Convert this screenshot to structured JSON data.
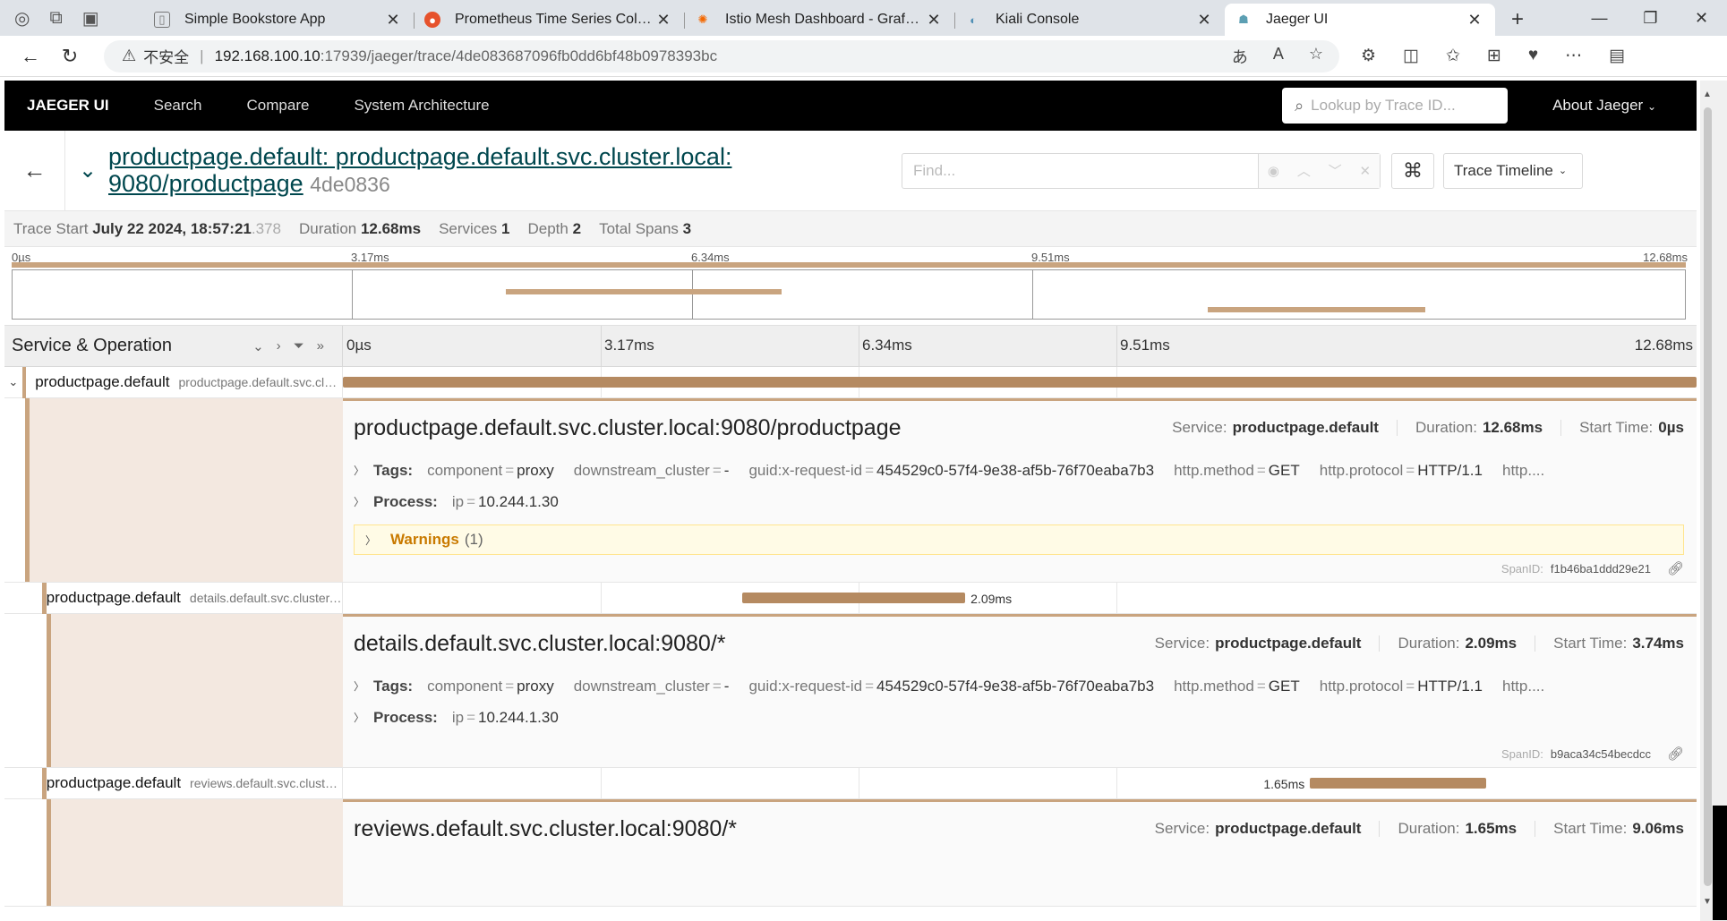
{
  "browser": {
    "tabs": [
      {
        "title": "Simple Bookstore App",
        "icon": "page-icon"
      },
      {
        "title": "Prometheus Time Series Collectio",
        "icon": "prometheus-icon"
      },
      {
        "title": "Istio Mesh Dashboard - Grafana",
        "icon": "grafana-icon"
      },
      {
        "title": "Kiali Console",
        "icon": "kiali-icon"
      },
      {
        "title": "Jaeger UI",
        "icon": "jaeger-icon"
      }
    ],
    "address": {
      "security": "不安全",
      "host": "192.168.100.10",
      "path": ":17939/jaeger/trace/4de083687096fb0dd6bf48b0978393bc"
    }
  },
  "nav": {
    "brand": "JAEGER UI",
    "links": [
      "Search",
      "Compare",
      "System Architecture"
    ],
    "lookup_placeholder": "Lookup by Trace ID...",
    "about": "About Jaeger"
  },
  "trace": {
    "title_line1": "productpage.default: productpage.default.svc.cluster.local:",
    "title_line2": "9080/productpage",
    "trace_id_short": "4de0836",
    "find_placeholder": "Find...",
    "view_mode": "Trace Timeline",
    "stats": {
      "start_label": "Trace Start",
      "start_value": "July 22 2024, 18:57:21",
      "start_ms": ".378",
      "duration_label": "Duration",
      "duration_value": "12.68ms",
      "services_label": "Services",
      "services_value": "1",
      "depth_label": "Depth",
      "depth_value": "2",
      "spans_label": "Total Spans",
      "spans_value": "3"
    },
    "ticks": [
      "0µs",
      "3.17ms",
      "6.34ms",
      "9.51ms",
      "12.68ms"
    ],
    "column_header": "Service & Operation"
  },
  "spans": [
    {
      "service": "productpage.default",
      "operation": "productpage.default.svc.cluster.local:9080/productpage",
      "row_operation": "productpage.default.svc.cluster.local:...",
      "start_ms": 0,
      "duration_ms": 12.68,
      "duration": "12.68ms",
      "start_time": "0µs",
      "tags": [
        {
          "k": "component",
          "v": "proxy"
        },
        {
          "k": "downstream_cluster",
          "v": "-"
        },
        {
          "k": "guid:x-request-id",
          "v": "454529c0-57f4-9e38-af5b-76f70eaba7b3"
        },
        {
          "k": "http.method",
          "v": "GET"
        },
        {
          "k": "http.protocol",
          "v": "HTTP/1.1"
        }
      ],
      "tags_more": "http....",
      "process": [
        {
          "k": "ip",
          "v": "10.244.1.30"
        }
      ],
      "warnings_label": "Warnings",
      "warnings_count": "(1)",
      "span_id": "f1b46ba1ddd29e21"
    },
    {
      "service": "productpage.default",
      "operation": "details.default.svc.cluster.local:9080/*",
      "row_operation": "details.default.svc.cluster.local:9...",
      "start_ms": 3.74,
      "duration_ms": 2.09,
      "duration": "2.09ms",
      "start_time": "3.74ms",
      "tags": [
        {
          "k": "component",
          "v": "proxy"
        },
        {
          "k": "downstream_cluster",
          "v": "-"
        },
        {
          "k": "guid:x-request-id",
          "v": "454529c0-57f4-9e38-af5b-76f70eaba7b3"
        },
        {
          "k": "http.method",
          "v": "GET"
        },
        {
          "k": "http.protocol",
          "v": "HTTP/1.1"
        }
      ],
      "tags_more": "http....",
      "process": [
        {
          "k": "ip",
          "v": "10.244.1.30"
        }
      ],
      "span_id": "b9aca34c54becdcc"
    },
    {
      "service": "productpage.default",
      "operation": "reviews.default.svc.cluster.local:9080/*",
      "row_operation": "reviews.default.svc.cluster.local:...",
      "start_ms": 9.06,
      "duration_ms": 1.65,
      "duration": "1.65ms",
      "start_time": "9.06ms"
    }
  ],
  "labels": {
    "tags": "Tags:",
    "process": "Process:",
    "service": "Service:",
    "duration": "Duration:",
    "start_time": "Start Time:",
    "span_id": "SpanID:"
  },
  "colors": {
    "span_bar": "#b58a61",
    "span_light": "#c9a47f",
    "title_link": "#00474e",
    "warning": "#c97a00"
  }
}
